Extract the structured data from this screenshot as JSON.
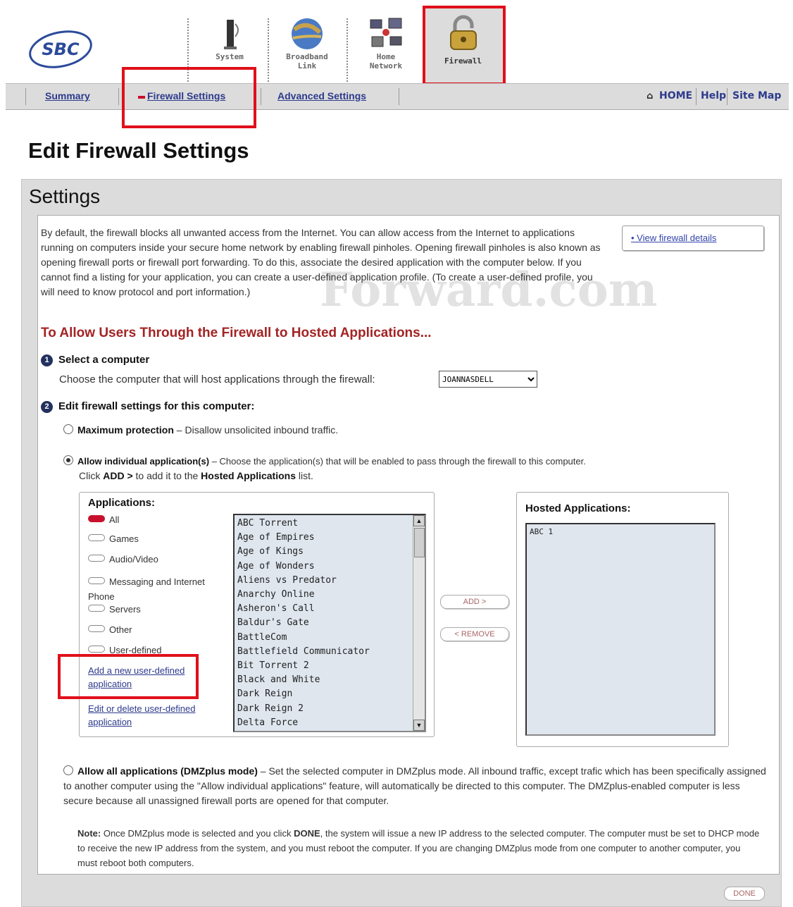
{
  "header": {
    "logo_text": "SBC",
    "tabs": [
      {
        "label_line1": "System",
        "label_line2": ""
      },
      {
        "label_line1": "Broadband",
        "label_line2": "Link"
      },
      {
        "label_line1": "Home",
        "label_line2": "Network"
      }
    ],
    "active_tab": "Firewall"
  },
  "subnav": {
    "summary": "Summary",
    "firewall_settings": "Firewall Settings",
    "advanced_settings": "Advanced Settings",
    "home": "HOME",
    "help": "Help",
    "site_map": "Site Map"
  },
  "page_title": "Edit Firewall Settings",
  "panel": {
    "title": "Settings",
    "intro": "By default, the firewall blocks all unwanted access from the Internet. You can allow access from the Internet to applications running on computers inside your secure home network by enabling firewall pinholes. Opening firewall pinholes is also known as opening firewall ports or firewall port forwarding. To do this, associate the desired application with the computer below. If you cannot find a listing for your application, you can create a user-defined application profile. (To create a user-defined profile, you will need to know protocol and port information.)",
    "view_details": "• View firewall details",
    "watermark": "Forward.com",
    "section_title": "To Allow Users Through the Firewall to Hosted Applications...",
    "step1_title": "Select a computer",
    "step1_text": "Choose the computer that will host applications through the firewall:",
    "computer": "JOANNASDELL",
    "step2_title": "Edit firewall settings for this computer:",
    "max_protection_label": "Maximum protection",
    "max_protection_text": "– Disallow unsolicited inbound traffic.",
    "allow_individual_label": "Allow individual application(s)",
    "allow_individual_text": "– Choose the application(s) that will be enabled to pass through the firewall to this computer.",
    "allow_individual_text2a": "Click ",
    "allow_individual_text2b": "ADD >",
    "allow_individual_text2c": " to add it to the ",
    "allow_individual_text2d": "Hosted Applications",
    "allow_individual_text2e": " list.",
    "applications_title": "Applications:",
    "categories": [
      "All",
      "Games",
      "Audio/Video",
      "Messaging and Internet Phone",
      "Servers",
      "Other",
      "User-defined"
    ],
    "add_user_defined": "Add a new user-defined application",
    "edit_user_defined": "Edit or delete user-defined application",
    "app_list": [
      "ABC Torrent",
      "Age of Empires",
      "Age of Kings",
      "Age of Wonders",
      "Aliens vs Predator",
      "Anarchy Online",
      "Asheron's Call",
      "Baldur's Gate",
      "BattleCom",
      "Battlefield Communicator",
      "Bit Torrent 2",
      "Black and White",
      "Dark Reign",
      "Dark Reign 2",
      "Delta Force"
    ],
    "add_button": "ADD >",
    "remove_button": "< REMOVE",
    "hosted_title": "Hosted Applications:",
    "hosted_list": "ABC 1",
    "dmz_label": "Allow all applications (DMZplus mode)",
    "dmz_text": "– Set the selected computer in DMZplus mode. All inbound traffic, except trafic which has been specifically assigned to another computer using the \"Allow individual applications\" feature, will automatically be directed to this computer. The DMZplus-enabled computer is less secure because all unassigned firewall ports are opened for that computer.",
    "note_label": "Note:",
    "note_text_a": " Once DMZplus mode is selected and you click ",
    "note_text_b": "DONE",
    "note_text_c": ", the system will issue a new IP address to the selected computer. The computer must be set to DHCP mode to receive the new IP address from the system, and you must reboot the computer. If you are changing DMZplus mode from one computer to another computer, you must reboot both computers.",
    "done": "DONE"
  },
  "colors": {
    "highlight_red": "#e0101a",
    "section_title": "#a32324",
    "link": "#2d3a8c"
  }
}
